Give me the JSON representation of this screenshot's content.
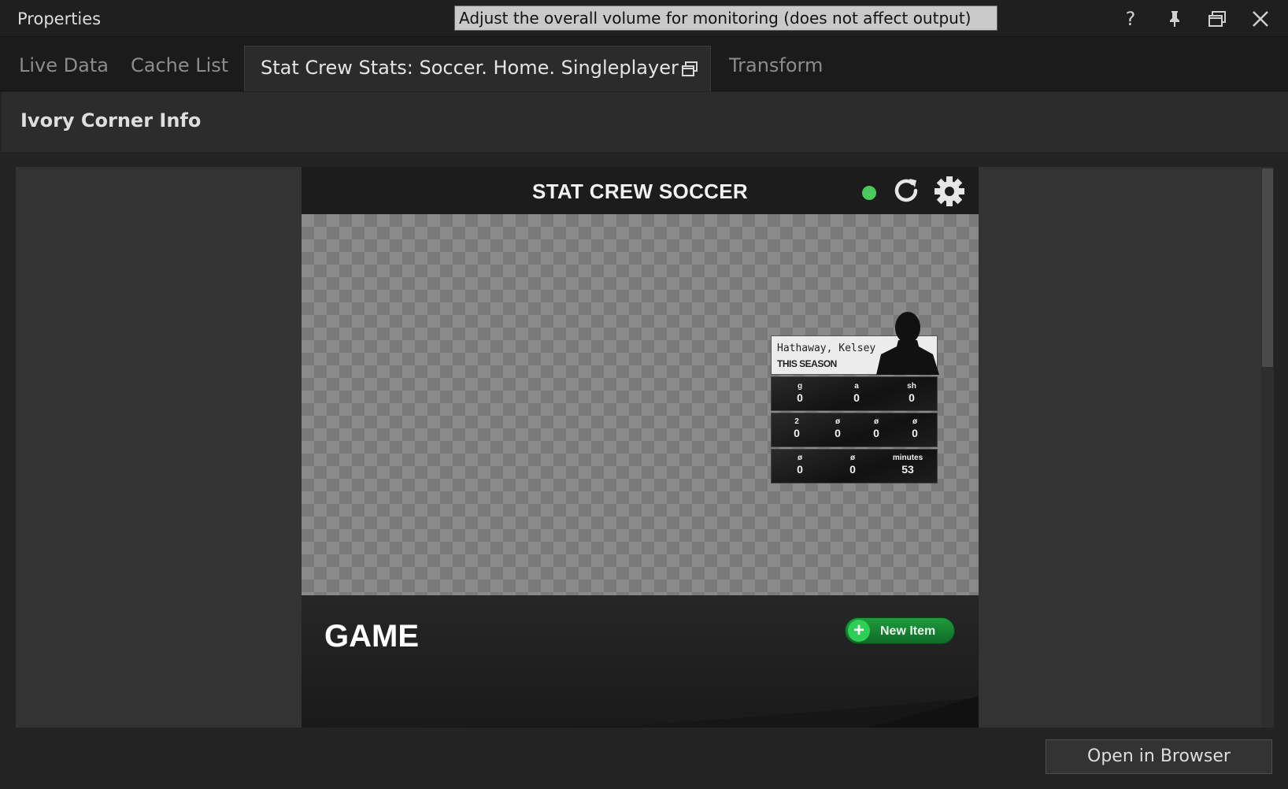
{
  "window": {
    "title": "Properties",
    "tooltip": "Adjust the overall volume for monitoring (does not affect output)",
    "help_label": "?",
    "icons": [
      "pin-icon",
      "restore-icon",
      "close-icon"
    ]
  },
  "tabs": [
    {
      "label": "Live Data",
      "active": false
    },
    {
      "label": "Cache List",
      "active": false
    },
    {
      "label": "Stat Crew Stats: Soccer. Home. Singleplayer",
      "active": true
    },
    {
      "label": "Transform",
      "active": false
    }
  ],
  "section": {
    "title": "Ivory Corner Info"
  },
  "app": {
    "title": "STAT CREW SOCCER",
    "status_color": "#4cc95e",
    "card": {
      "name": "Hathaway, Kelsey",
      "subtitle": "THIS SEASON",
      "row1": [
        {
          "label": "g",
          "value": "0"
        },
        {
          "label": "a",
          "value": "0"
        },
        {
          "label": "sh",
          "value": "0"
        }
      ],
      "row2": [
        {
          "label": "2",
          "value": "0"
        },
        {
          "label": "ø",
          "value": "0"
        },
        {
          "label": "ø",
          "value": "0"
        },
        {
          "label": "ø",
          "value": "0"
        }
      ],
      "row3": [
        {
          "label": "ø",
          "value": "0"
        },
        {
          "label": "ø",
          "value": "0"
        },
        {
          "label": "minutes",
          "value": "53"
        }
      ]
    },
    "game_title": "GAME",
    "new_item_label": "New Item",
    "new_item_plus": "+"
  },
  "footer": {
    "open_browser_label": "Open in Browser"
  }
}
